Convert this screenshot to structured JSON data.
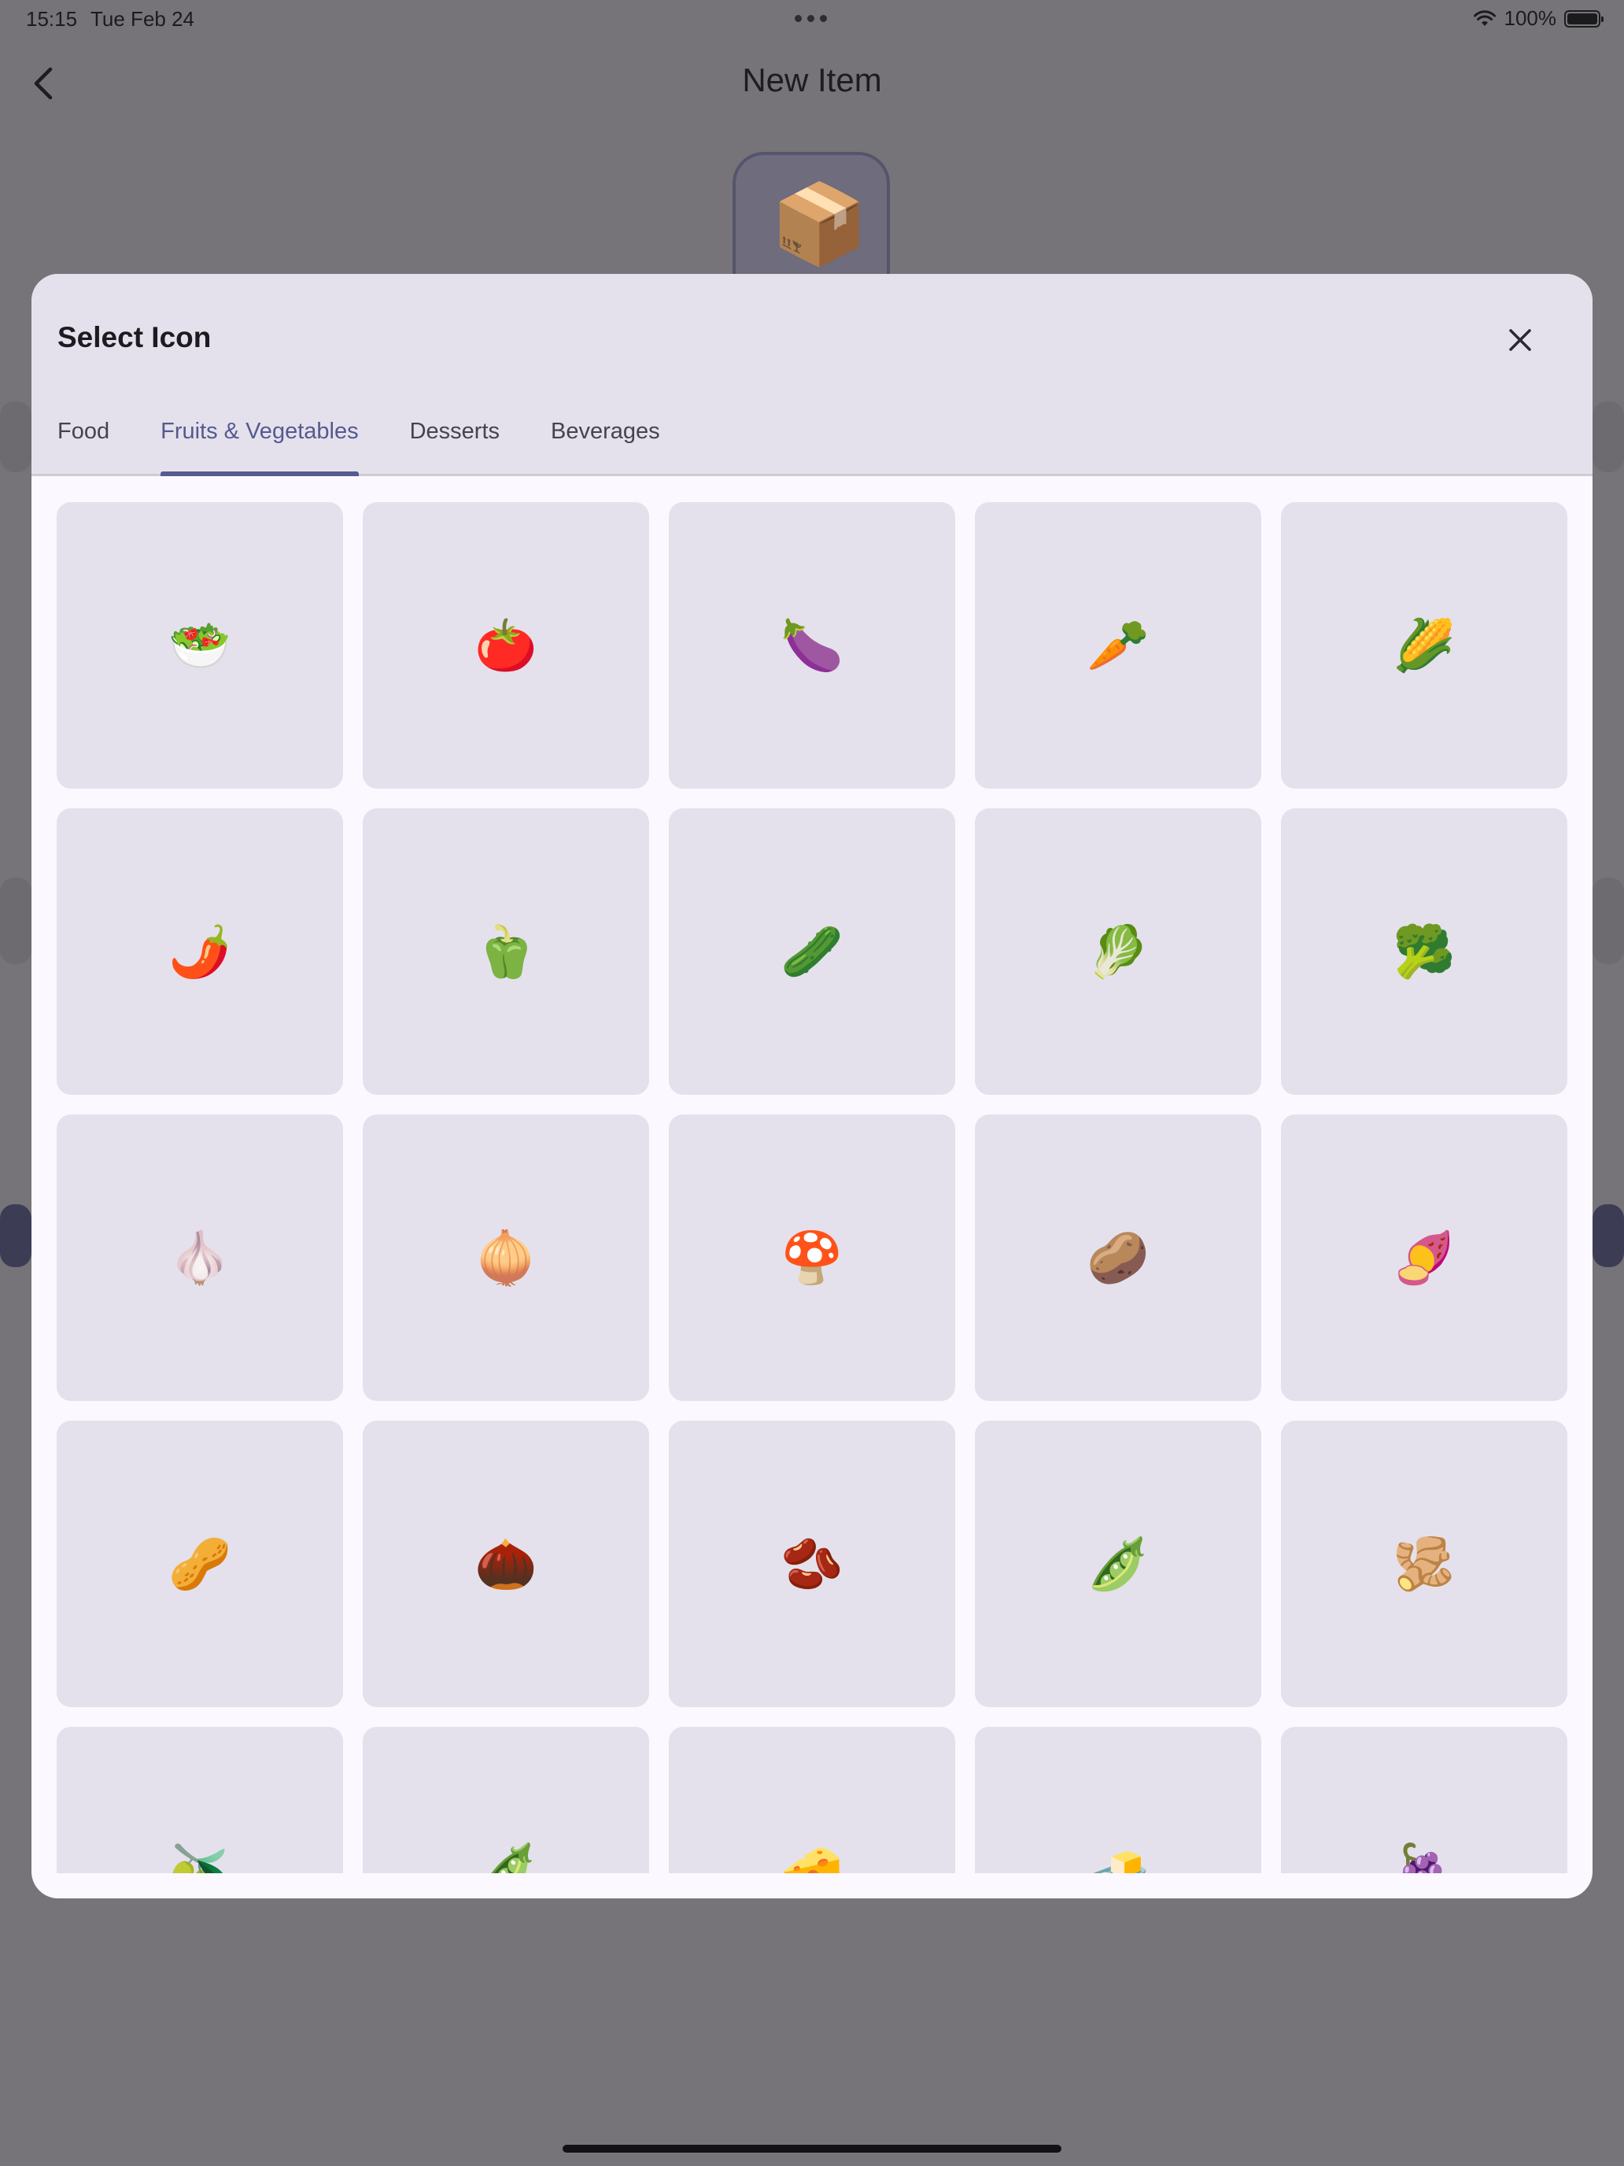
{
  "status_bar": {
    "time": "15:15",
    "date": "Tue Feb 24",
    "battery_percent": "100%"
  },
  "page": {
    "title": "New Item",
    "item_icon": "📦"
  },
  "modal": {
    "title": "Select Icon",
    "tabs": [
      {
        "label": "Food",
        "active": false
      },
      {
        "label": "Fruits & Vegetables",
        "active": true
      },
      {
        "label": "Desserts",
        "active": false
      },
      {
        "label": "Beverages",
        "active": false
      }
    ],
    "icons": [
      "🥗",
      "🍅",
      "🍆",
      "🥕",
      "🌽",
      "🌶️",
      "🫑",
      "🥒",
      "🥬",
      "🥦",
      "🧄",
      "🧅",
      "🍄",
      "🥔",
      "🍠",
      "🥜",
      "🌰",
      "🫘",
      "🫛",
      "🫚",
      "🫒",
      "🫛",
      "🧀",
      "🧈",
      "🍇"
    ]
  },
  "colors": {
    "accent": "#55598f",
    "tile": "#e4e1ec",
    "scrim": "#767479"
  }
}
